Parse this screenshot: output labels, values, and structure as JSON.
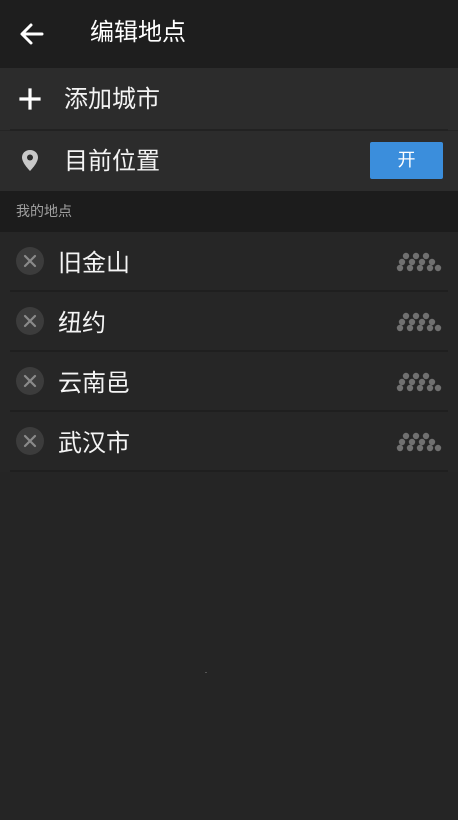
{
  "appbar": {
    "title": "编辑地点",
    "back_icon": "arrow-left-icon"
  },
  "add_city": {
    "label": "添加城市",
    "icon": "plus-icon"
  },
  "current_location": {
    "label": "目前位置",
    "icon": "map-pin-icon",
    "toggle_label": "开",
    "toggle_on": true
  },
  "section": {
    "my_places": "我的地点"
  },
  "cities": [
    {
      "name": "旧金山"
    },
    {
      "name": "纽约"
    },
    {
      "name": "云南邑"
    },
    {
      "name": "武汉市"
    }
  ],
  "colors": {
    "accent": "#3b8edc",
    "background": "#252525",
    "appbar": "#1e1e1e"
  }
}
